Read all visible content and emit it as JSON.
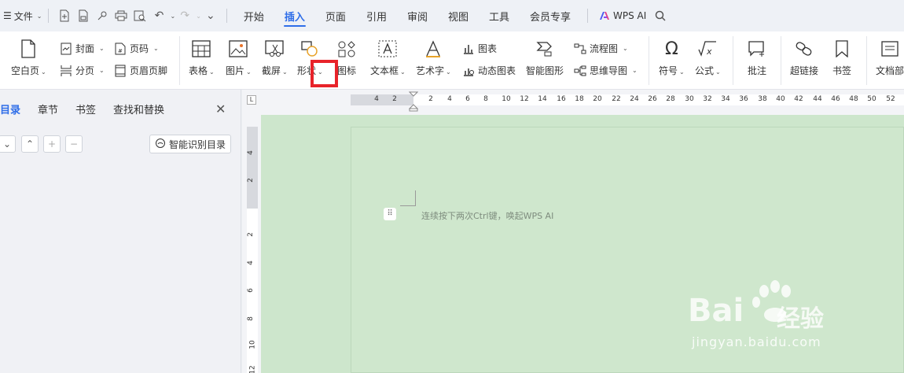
{
  "menubar": {
    "file_label": "文件",
    "tabs": [
      {
        "label": "开始"
      },
      {
        "label": "插入"
      },
      {
        "label": "页面"
      },
      {
        "label": "引用"
      },
      {
        "label": "审阅"
      },
      {
        "label": "视图"
      },
      {
        "label": "工具"
      },
      {
        "label": "会员专享"
      }
    ],
    "active_tab": "插入",
    "wps_ai_label": "WPS AI"
  },
  "ribbon": {
    "blank_page": "空白页",
    "cover": "封面",
    "page_break": "分页",
    "page_number": "页码",
    "header_footer": "页眉页脚",
    "table": "表格",
    "picture": "图片",
    "screenshot": "截屏",
    "shape": "形状",
    "icon": "图标",
    "textbox": "文本框",
    "wordart": "艺术字",
    "chart": "图表",
    "dynamic_chart": "动态图表",
    "smart_graphic": "智能图形",
    "flowchart": "流程图",
    "mindmap": "思维导图",
    "symbol": "符号",
    "formula": "公式",
    "comment": "批注",
    "hyperlink": "超链接",
    "bookmark": "书签",
    "doc_part": "文档部"
  },
  "leftpanel": {
    "tabs": [
      {
        "label": "目录"
      },
      {
        "label": "章节"
      },
      {
        "label": "书签"
      },
      {
        "label": "查找和替换"
      }
    ],
    "smart_toc_label": "智能识别目录"
  },
  "ruler": {
    "h_left": [
      "4",
      "2"
    ],
    "h_right": [
      "2",
      "4",
      "6",
      "8",
      "10",
      "12",
      "14",
      "16",
      "18",
      "20",
      "22",
      "24",
      "26",
      "28",
      "30",
      "32",
      "34",
      "36",
      "38",
      "40",
      "42",
      "44",
      "46",
      "48",
      "50",
      "52"
    ],
    "v_top": [
      "4",
      "2"
    ],
    "v_bottom": [
      "2",
      "4",
      "6",
      "8",
      "10",
      "12"
    ]
  },
  "document": {
    "placeholder": "连续按下两次Ctrl键，唤起WPS AI"
  },
  "watermark": {
    "brand": "Bai",
    "brand_cn": "经验",
    "url": "jingyan.baidu.com"
  },
  "colors": {
    "accent": "#2f6ee8",
    "page_bg": "#cfe7cd",
    "highlight": "#e8232a"
  }
}
